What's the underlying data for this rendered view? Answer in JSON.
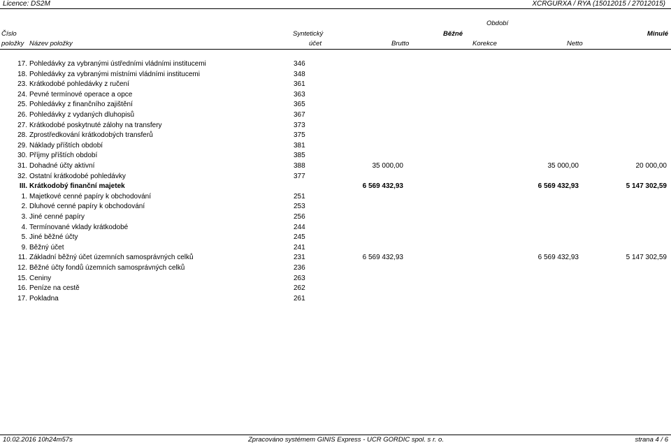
{
  "topbar": {
    "licence": "Licence: DS2M",
    "code": "XCRGURXA / RYA  (15012015 / 27012015)"
  },
  "header": {
    "obdobi": "Období",
    "cislo": "Číslo",
    "polozky": "položky",
    "nazev": "Název položky",
    "synteticky": "Syntetický",
    "ucet": "účet",
    "bezne": "Běžné",
    "minule": "Minulé",
    "brutto": "Brutto",
    "korekce": "Korekce",
    "netto": "Netto"
  },
  "rows": [
    {
      "num": "17.",
      "name": "Pohledávky za vybranými ústředními vládními institucemi",
      "acct": "346",
      "brutto": "",
      "netto": "",
      "minule": "",
      "bold": false
    },
    {
      "num": "18.",
      "name": "Pohledávky za vybranými místními vládními institucemi",
      "acct": "348",
      "brutto": "",
      "netto": "",
      "minule": "",
      "bold": false
    },
    {
      "num": "23.",
      "name": "Krátkodobé pohledávky z ručení",
      "acct": "361",
      "brutto": "",
      "netto": "",
      "minule": "",
      "bold": false
    },
    {
      "num": "24.",
      "name": "Pevné termínové operace a opce",
      "acct": "363",
      "brutto": "",
      "netto": "",
      "minule": "",
      "bold": false
    },
    {
      "num": "25.",
      "name": "Pohledávky z finančního zajištění",
      "acct": "365",
      "brutto": "",
      "netto": "",
      "minule": "",
      "bold": false
    },
    {
      "num": "26.",
      "name": "Pohledávky z vydaných dluhopisů",
      "acct": "367",
      "brutto": "",
      "netto": "",
      "minule": "",
      "bold": false
    },
    {
      "num": "27.",
      "name": "Krátkodobé poskytnuté zálohy na transfery",
      "acct": "373",
      "brutto": "",
      "netto": "",
      "minule": "",
      "bold": false
    },
    {
      "num": "28.",
      "name": "Zprostředkování krátkodobých transferů",
      "acct": "375",
      "brutto": "",
      "netto": "",
      "minule": "",
      "bold": false
    },
    {
      "num": "29.",
      "name": "Náklady příštích období",
      "acct": "381",
      "brutto": "",
      "netto": "",
      "minule": "",
      "bold": false
    },
    {
      "num": "30.",
      "name": "Příjmy příštích období",
      "acct": "385",
      "brutto": "",
      "netto": "",
      "minule": "",
      "bold": false
    },
    {
      "num": "31.",
      "name": "Dohadné účty aktivní",
      "acct": "388",
      "brutto": "35 000,00",
      "netto": "35 000,00",
      "minule": "20 000,00",
      "bold": false
    },
    {
      "num": "32.",
      "name": "Ostatní krátkodobé pohledávky",
      "acct": "377",
      "brutto": "",
      "netto": "",
      "minule": "",
      "bold": false
    },
    {
      "num": "III.",
      "name": "Krátkodobý finanční majetek",
      "acct": "",
      "brutto": "6 569 432,93",
      "netto": "6 569 432,93",
      "minule": "5 147 302,59",
      "bold": true
    },
    {
      "num": "1.",
      "name": "Majetkové cenné papíry k obchodování",
      "acct": "251",
      "brutto": "",
      "netto": "",
      "minule": "",
      "bold": false
    },
    {
      "num": "2.",
      "name": "Dluhové cenné papíry k obchodování",
      "acct": "253",
      "brutto": "",
      "netto": "",
      "minule": "",
      "bold": false
    },
    {
      "num": "3.",
      "name": "Jiné cenné papíry",
      "acct": "256",
      "brutto": "",
      "netto": "",
      "minule": "",
      "bold": false
    },
    {
      "num": "4.",
      "name": "Termínované vklady krátkodobé",
      "acct": "244",
      "brutto": "",
      "netto": "",
      "minule": "",
      "bold": false
    },
    {
      "num": "5.",
      "name": "Jiné běžné účty",
      "acct": "245",
      "brutto": "",
      "netto": "",
      "minule": "",
      "bold": false
    },
    {
      "num": "9.",
      "name": "Běžný účet",
      "acct": "241",
      "brutto": "",
      "netto": "",
      "minule": "",
      "bold": false
    },
    {
      "num": "11.",
      "name": "Základní běžný účet územních samosprávných celků",
      "acct": "231",
      "brutto": "6 569 432,93",
      "netto": "6 569 432,93",
      "minule": "5 147 302,59",
      "bold": false
    },
    {
      "num": "12.",
      "name": "Běžné účty fondů územních samosprávných celků",
      "acct": "236",
      "brutto": "",
      "netto": "",
      "minule": "",
      "bold": false
    },
    {
      "num": "15.",
      "name": "Ceniny",
      "acct": "263",
      "brutto": "",
      "netto": "",
      "minule": "",
      "bold": false
    },
    {
      "num": "16.",
      "name": "Peníze na cestě",
      "acct": "262",
      "brutto": "",
      "netto": "",
      "minule": "",
      "bold": false
    },
    {
      "num": "17.",
      "name": "Pokladna",
      "acct": "261",
      "brutto": "",
      "netto": "",
      "minule": "",
      "bold": false
    }
  ],
  "footer": {
    "date": "10.02.2016 10h24m57s",
    "system": "Zpracováno systémem GINIS Express - UCR GORDIC spol. s r. o.",
    "page": "strana 4 / 6"
  }
}
